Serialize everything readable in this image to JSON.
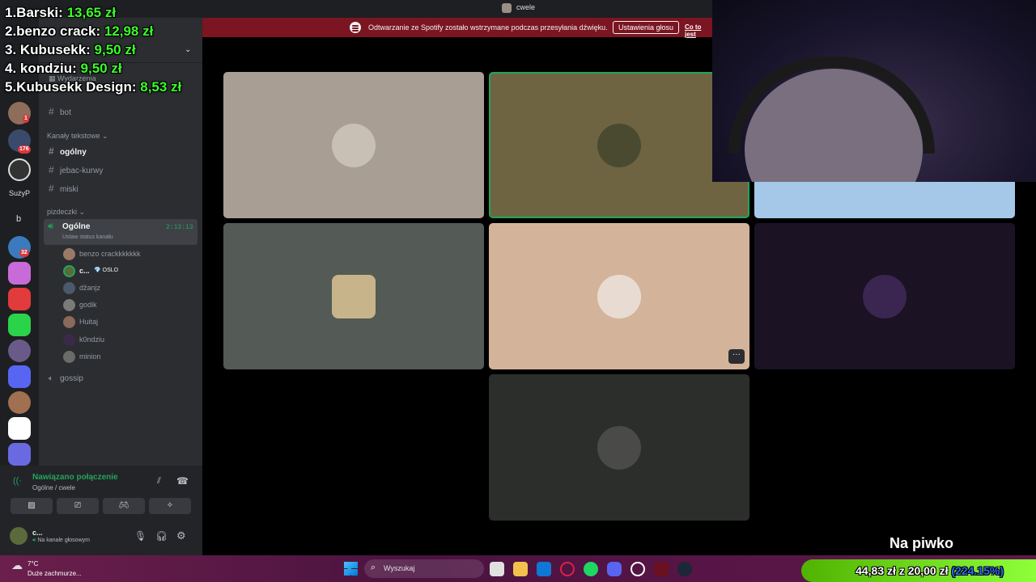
{
  "window": {
    "title": "cwele"
  },
  "notice": {
    "message": "Odtwarzanie ze Spotify zostało wstrzymane podczas przesyłania dźwięku.",
    "button": "Ustawienia głosu",
    "link": "Co to jest"
  },
  "leaderboard": [
    {
      "label": "1.Barski:",
      "amount": "13,65 zł"
    },
    {
      "label": "2.benzo crack:",
      "amount": "12,98 zł"
    },
    {
      "label": "3. Kubusekk:",
      "amount": "9,50 zł"
    },
    {
      "label": "4. kondziu:",
      "amount": "9,50 zł"
    },
    {
      "label": "5.Kubusekk Design:",
      "amount": "8,53 zł"
    }
  ],
  "rail": {
    "badges": [
      "1",
      "176",
      "32"
    ],
    "text_items": [
      "SużyP",
      "b"
    ]
  },
  "channels": {
    "events_label": "Wydarzenia",
    "bot": "bot",
    "text_category": "Kanały tekstowe",
    "text_channels": [
      "ogólny",
      "jebac-kurwy",
      "miski"
    ],
    "voice_category": "pizdeczki",
    "active_voice": {
      "name": "Ogólne",
      "status": "Ustaw status kanału",
      "timer": "2:13:13"
    },
    "members": [
      "benzo crackkkkkkk",
      "c...",
      "džanįz",
      "godik",
      "Huitaj",
      "k0ndziu",
      "minion"
    ],
    "member_tag": "OSLO",
    "other_voice": "gossip"
  },
  "voice_panel": {
    "status": "Nawiązano połączenie",
    "location": "Ogólne / cwele",
    "user": "c...",
    "user_status": "Na kanale głosowym"
  },
  "overlay": {
    "caption": "Na piwko"
  },
  "goal": {
    "current": "44,83 zł",
    "sep": "z",
    "target": "20,00 zł",
    "percent": "(224.15%)"
  },
  "taskbar": {
    "weather_temp": "7°C",
    "weather_desc": "Duże zachmurze...",
    "search_placeholder": "Wyszukaj"
  },
  "colors": {
    "accent_green": "#3cff2a",
    "notice_bg": "#7a1521",
    "connected": "#23a55a"
  }
}
